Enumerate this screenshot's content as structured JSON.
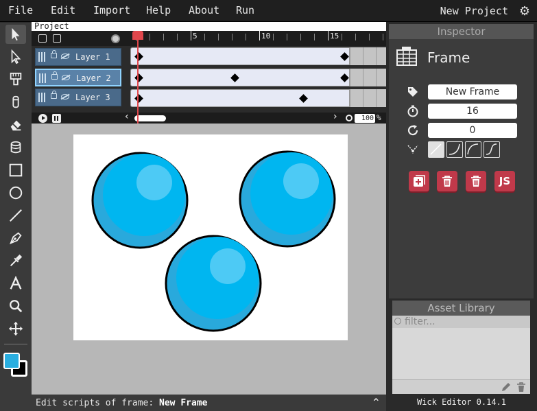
{
  "menu": {
    "items": [
      "File",
      "Edit",
      "Import",
      "Help",
      "About",
      "Run"
    ],
    "project_name": "New Project"
  },
  "timeline": {
    "breadcrumb": "Project",
    "ruler_labels": [
      "5",
      "10",
      "15"
    ],
    "layers": [
      {
        "name": "Layer 1",
        "selected": false
      },
      {
        "name": "Layer 2",
        "selected": true
      },
      {
        "name": "Layer 3",
        "selected": false
      }
    ],
    "zoom": "100",
    "zoom_unit": "%"
  },
  "stage": {
    "fill_color": "#29aee0",
    "stroke_color": "#000000"
  },
  "scriptbar": {
    "label": "Edit scripts of frame:",
    "frame_name": "New Frame"
  },
  "inspector": {
    "title": "Inspector",
    "selection_type": "Frame",
    "name_value": "New Frame",
    "duration_value": "16",
    "rotation_value": "0",
    "actions": [
      "add-frame",
      "delete-frame",
      "delete",
      "JS"
    ]
  },
  "assets": {
    "title": "Asset Library",
    "filter_placeholder": "filter..."
  },
  "footer": {
    "version": "Wick Editor 0.14.1"
  },
  "colors": {
    "accent": "#c0394a",
    "layer": "#4a6a8a",
    "layer_selected": "#5a82a8",
    "playhead": "#e0474c",
    "circle": "#00b6f0"
  }
}
